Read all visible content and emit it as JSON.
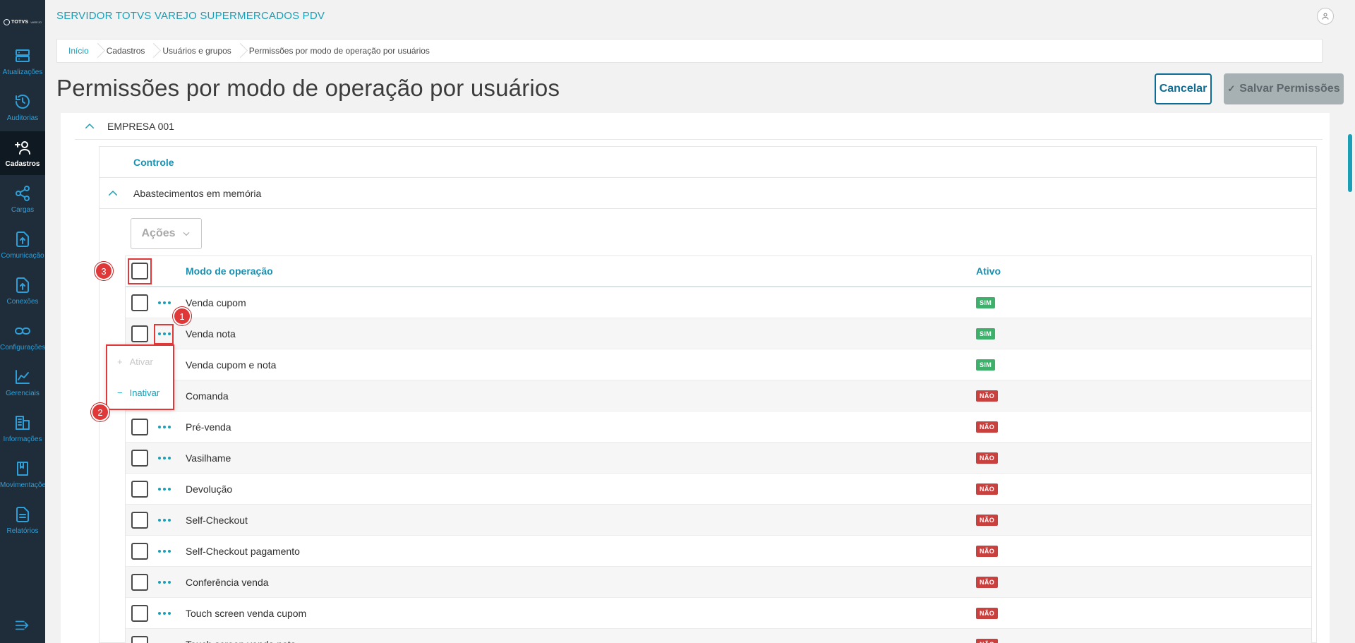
{
  "logo": {
    "text": "TOTVS",
    "sub": "VAREJO"
  },
  "app_title": "SERVIDOR TOTVS VAREJO SUPERMERCADOS PDV",
  "sidebar": {
    "items": [
      {
        "label": "Atualizações",
        "icon": "server-icon"
      },
      {
        "label": "Auditorias",
        "icon": "history-icon"
      },
      {
        "label": "Cadastros",
        "icon": "add-user-icon",
        "active": true
      },
      {
        "label": "Cargas",
        "icon": "share-icon"
      },
      {
        "label": "Comunicação",
        "icon": "upload-doc-icon"
      },
      {
        "label": "Conexões",
        "icon": "upload-doc-icon"
      },
      {
        "label": "Configurações",
        "icon": "link-icon"
      },
      {
        "label": "Gerenciais",
        "icon": "chart-icon"
      },
      {
        "label": "Informações",
        "icon": "building-icon"
      },
      {
        "label": "Movimentações",
        "icon": "book-icon"
      },
      {
        "label": "Relatórios",
        "icon": "report-icon"
      }
    ]
  },
  "breadcrumb": [
    "Início",
    "Cadastros",
    "Usuários e grupos",
    "Permissões por modo de operação por usuários"
  ],
  "page": {
    "title": "Permissões por modo de operação por usuários",
    "cancel_label": "Cancelar",
    "save_label": "Salvar Permissões"
  },
  "empresa": "EMPRESA 001",
  "controle": "Controle",
  "abastecimentos": "Abastecimentos em memória",
  "acoes_label": "Ações",
  "table": {
    "headers": {
      "modo": "Modo de operação",
      "ativo": "Ativo"
    },
    "rows": [
      {
        "name": "Venda cupom",
        "ativo": "SIM"
      },
      {
        "name": "Venda nota",
        "ativo": "SIM"
      },
      {
        "name": "Venda cupom e nota",
        "ativo": "SIM"
      },
      {
        "name": "Comanda",
        "ativo": "NÃO"
      },
      {
        "name": "Pré-venda",
        "ativo": "NÃO"
      },
      {
        "name": "Vasilhame",
        "ativo": "NÃO"
      },
      {
        "name": "Devolução",
        "ativo": "NÃO"
      },
      {
        "name": "Self-Checkout",
        "ativo": "NÃO"
      },
      {
        "name": "Self-Checkout pagamento",
        "ativo": "NÃO"
      },
      {
        "name": "Conferência venda",
        "ativo": "NÃO"
      },
      {
        "name": "Touch screen venda cupom",
        "ativo": "NÃO"
      },
      {
        "name": "Touch screen venda nota",
        "ativo": "NÃO"
      }
    ]
  },
  "popup": {
    "ativar": "Ativar",
    "inativar": "Inativar",
    "ativar_symbol": "+",
    "inativar_symbol": "−"
  },
  "annotations": [
    "1",
    "2",
    "3"
  ],
  "colors": {
    "accent": "#1a9fb7",
    "sidebar_bg": "#1f2d3a",
    "sim": "#3fb06b",
    "nao": "#c9413f",
    "annotation": "#e03838"
  }
}
